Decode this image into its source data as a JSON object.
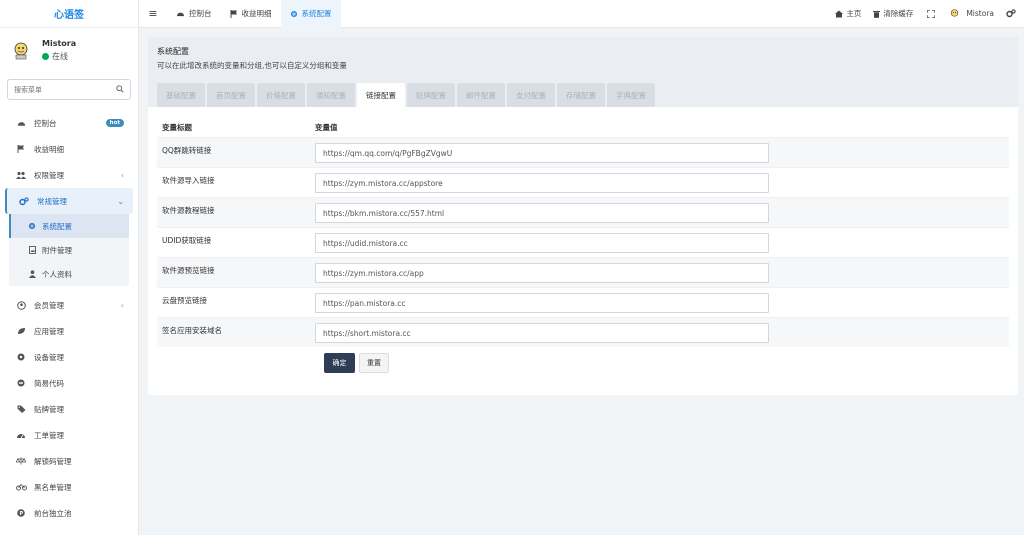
{
  "app": {
    "logo": "心语签"
  },
  "user": {
    "name": "Mistora",
    "status": "在线"
  },
  "search": {
    "placeholder": "搜索菜单"
  },
  "sidebar": {
    "items": [
      {
        "label": "控制台",
        "icon": "dashboard-icon",
        "badge": "hot"
      },
      {
        "label": "收益明细",
        "icon": "flag-icon"
      },
      {
        "label": "权限管理",
        "icon": "users-icon"
      },
      {
        "label": "常规管理",
        "icon": "cogs-icon"
      },
      {
        "label": "会员管理",
        "icon": "user-circle-icon"
      },
      {
        "label": "应用管理",
        "icon": "leaf-icon"
      },
      {
        "label": "设备管理",
        "icon": "circle-icon"
      },
      {
        "label": "简易代码",
        "icon": "dot-circle-icon"
      },
      {
        "label": "贴牌管理",
        "icon": "tags-icon"
      },
      {
        "label": "工单管理",
        "icon": "tachometer-icon"
      },
      {
        "label": "解锁码管理",
        "icon": "balance-icon"
      },
      {
        "label": "黑名单管理",
        "icon": "bicycle-icon"
      },
      {
        "label": "前台独立池",
        "icon": "parking-icon"
      }
    ],
    "submenu": [
      {
        "label": "系统配置",
        "icon": "gear-icon"
      },
      {
        "label": "附件管理",
        "icon": "file-image-icon"
      },
      {
        "label": "个人资料",
        "icon": "user-icon"
      }
    ]
  },
  "topbar": {
    "tabs": [
      {
        "label": "控制台",
        "icon": "dashboard-icon"
      },
      {
        "label": "收益明细",
        "icon": "flag-icon"
      },
      {
        "label": "系统配置",
        "icon": "gear-icon"
      }
    ],
    "right": {
      "home": "主页",
      "clear_cache": "清除缓存",
      "username": "Mistora"
    }
  },
  "page": {
    "title": "系统配置",
    "description": "可以在此增改系统的变量和分组,也可以自定义分组和变量",
    "tabs": [
      "基础配置",
      "首页配置",
      "价格配置",
      "通知配置",
      "链接配置",
      "贴牌配置",
      "邮件配置",
      "支付配置",
      "存储配置",
      "字典配置"
    ],
    "active_tab": "链接配置"
  },
  "table": {
    "headers": [
      "变量标题",
      "变量值"
    ],
    "rows": [
      {
        "title": "QQ群跳转链接",
        "value": "https://qm.qq.com/q/PgFBgZVgwU"
      },
      {
        "title": "软件源导入链接",
        "value": "https://zym.mistora.cc/appstore"
      },
      {
        "title": "软件源教程链接",
        "value": "https://bkm.mistora.cc/557.html"
      },
      {
        "title": "UDID获取链接",
        "value": "https://udid.mistora.cc"
      },
      {
        "title": "软件源预览链接",
        "value": "https://zym.mistora.cc/app"
      },
      {
        "title": "云盘预览链接",
        "value": "https://pan.mistora.cc"
      },
      {
        "title": "签名应用安装域名",
        "value": "https://short.mistora.cc"
      }
    ]
  },
  "buttons": {
    "confirm": "确定",
    "reset": "重置"
  },
  "colors": {
    "accent": "#1e88e5",
    "primary_button": "#2f3d57",
    "online": "#00a65a"
  }
}
